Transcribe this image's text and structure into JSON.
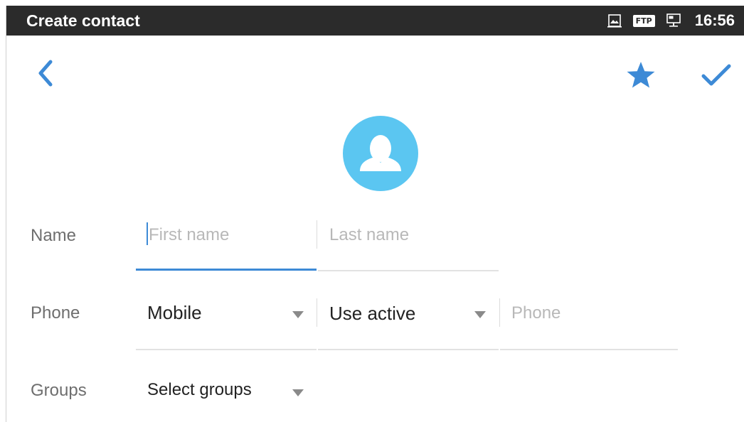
{
  "statusbar": {
    "title": "Create contact",
    "ftp_label": "FTP",
    "time": "16:56"
  },
  "form": {
    "name_label": "Name",
    "first_name_placeholder": "First name",
    "last_name_placeholder": "Last name",
    "phone_label": "Phone",
    "phone_type": "Mobile",
    "phone_account": "Use active",
    "phone_placeholder": "Phone",
    "groups_label": "Groups",
    "groups_value": "Select groups"
  },
  "colors": {
    "accent": "#3d8ad6",
    "avatar": "#5bc6f1",
    "statusbar": "#2b2b2b"
  }
}
